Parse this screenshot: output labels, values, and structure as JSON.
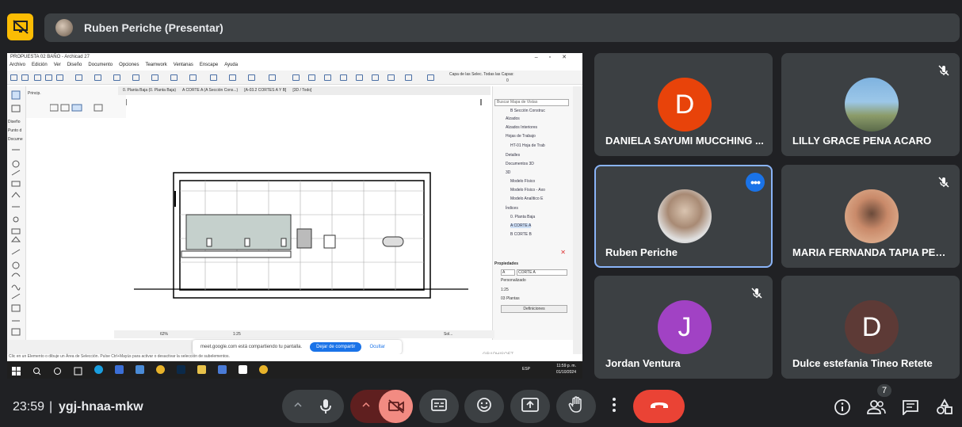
{
  "presenter": {
    "name": "Ruben Periche (Presentar)",
    "present_icon": "presentation-off-icon"
  },
  "shared_screen": {
    "window_title": "PROPUESTA 02 BAÑO - Archicad 27",
    "menu": [
      "Archivo",
      "Edición",
      "Ver",
      "Diseño",
      "Documento",
      "Opciones",
      "Teamwork",
      "Ventanas",
      "Enscape",
      "Ayuda"
    ],
    "toolbar_label_layers": "Capa de las Selec. Todas las Capas:",
    "toolbar_layer_value": "0",
    "tabs": [
      "0. Planta Baja (0. Planta Baja)",
      "A CORTE A (A Sección Cons...)",
      "[A-03.2 CORTES A Y B]",
      "[3D / Todo]"
    ],
    "left_labels": [
      "Princip.",
      "Diseño",
      "Punto d",
      "Docume"
    ],
    "search_placeholder": "Buscar Mapa de Vistas",
    "tree": [
      "B Sección Construc",
      "Alzados",
      "Alzados Interiores",
      "Hojas de Trabajo",
      "HT-01 Hoja de Trab",
      "Detalles",
      "Documentos 3D",
      "3D",
      "Modelo Físico",
      "Modelo Físico - Axo",
      "Modelo Analítico E",
      "Índices",
      "0. Planta Baja",
      "A CORTE A",
      "B CORTE B"
    ],
    "properties_title": "Propiedades",
    "properties": {
      "id": "A",
      "name": "CORTE A",
      "custom": "Personalizado",
      "scale": "1:25",
      "plans": "03 Plantas",
      "definitions_button": "Definiciones"
    },
    "status": {
      "zoom": "62%",
      "scale": "1:25",
      "other": "Sol..."
    },
    "share_notice": "meet.google.com está compartiendo tu pantalla.",
    "stop_share_button": "Dejar de compartir",
    "hide_link": "Ocultar",
    "info_line": "Clic en un Elemento o dibuje un Área de Selección. Pulse Ctrl+Mayús para activar o desactivar la selección de subelementos.",
    "graphisoft": "GRAPHISOFT",
    "taskbar_lang": "ESP",
    "taskbar_time": "11:59 p. m.",
    "taskbar_date": "01/10/2024"
  },
  "participants": [
    {
      "name": "DANIELA SAYUMI MUCCHING ...",
      "initial": "D",
      "color": "#e8430a",
      "muted": false
    },
    {
      "name": "LILLY GRACE PENA ACARO",
      "initial": "",
      "color": "#4a7fb5",
      "muted": true
    },
    {
      "name": "Ruben Periche",
      "initial": "",
      "color": "#9aa0a6",
      "muted": false,
      "active": true
    },
    {
      "name": "MARIA FERNANDA TAPIA PERA...",
      "initial": "",
      "color": "#c98a6a",
      "muted": true
    },
    {
      "name": "Jordan Ventura",
      "initial": "J",
      "color": "#a142c4",
      "muted": true
    },
    {
      "name": "Dulce estefania Tineo Retete",
      "initial": "D",
      "color": "#5d3a36",
      "muted": false
    }
  ],
  "bottom_bar": {
    "time": "23:59",
    "separator": "|",
    "meeting_code": "ygj-hnaa-mkw",
    "people_count": "7"
  },
  "colors": {
    "background": "#202124",
    "tile": "#3c4043",
    "accent": "#8ab4f8",
    "end_call": "#ea4335",
    "present_yellow": "#fbbc04"
  }
}
